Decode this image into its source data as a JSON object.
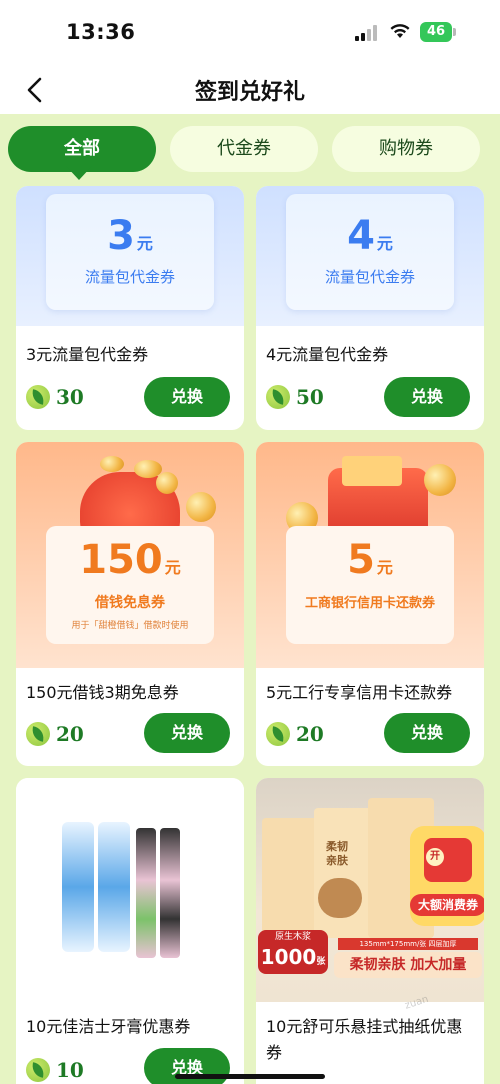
{
  "status": {
    "time": "13:36",
    "battery": "46"
  },
  "nav": {
    "title": "签到兑好礼"
  },
  "tabs": [
    {
      "label": "全部",
      "active": true
    },
    {
      "label": "代金券",
      "active": false
    },
    {
      "label": "购物券",
      "active": false
    }
  ],
  "cards": [
    {
      "voucher_amount": "3",
      "voucher_unit": "元",
      "voucher_sub": "流量包代金券",
      "title": "3元流量包代金券",
      "price": "30",
      "button": "兑换"
    },
    {
      "voucher_amount": "4",
      "voucher_unit": "元",
      "voucher_sub": "流量包代金券",
      "title": "4元流量包代金券",
      "price": "50",
      "button": "兑换"
    },
    {
      "voucher_amount": "150",
      "voucher_unit": "元",
      "voucher_sub": "借钱免息券",
      "voucher_note": "用于「甜橙借钱」借款时使用",
      "title": "150元借钱3期免息券",
      "price": "20",
      "button": "兑换"
    },
    {
      "voucher_amount": "5",
      "voucher_unit": "元",
      "voucher_sub": "工商银行信用卡还款券",
      "title": "5元工行专享信用卡还款券",
      "price": "20",
      "button": "兑换"
    },
    {
      "title": "10元佳洁士牙膏优惠券",
      "price": "10",
      "button": "兑换"
    },
    {
      "title": "10元舒可乐悬挂式抽纸优惠券",
      "promo_open": "开",
      "promo_big": "大额消费券",
      "promo_size": "135mm*175mm/张 四层加厚",
      "promo_material": "原生木浆",
      "promo_count": "1000",
      "promo_unit": "张",
      "promo_slogan": "柔韧亲肤 加大加量",
      "promo_box": "柔韧亲肤"
    }
  ],
  "colors": {
    "primary_green": "#1f8e2a",
    "page_bg": "#e6f4c3",
    "blue_voucher": "#3b7cf0",
    "orange_voucher": "#f07a1f"
  }
}
